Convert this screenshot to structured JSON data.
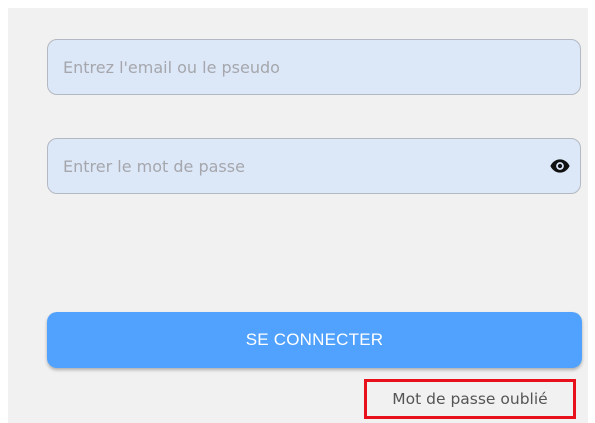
{
  "login_form": {
    "email_field": {
      "value": "",
      "placeholder": "Entrez l'email ou le pseudo"
    },
    "password_field": {
      "value": "",
      "placeholder": "Entrer le mot de passe",
      "toggle_icon": "eye-icon"
    },
    "submit_label": "SE CONNECTER",
    "forgot_password_label": "Mot de passe oublié"
  },
  "colors": {
    "background": "#f1f1f1",
    "input_background": "#dce7f8",
    "primary_button": "#51a2ff",
    "highlight_border": "#e8101a"
  }
}
